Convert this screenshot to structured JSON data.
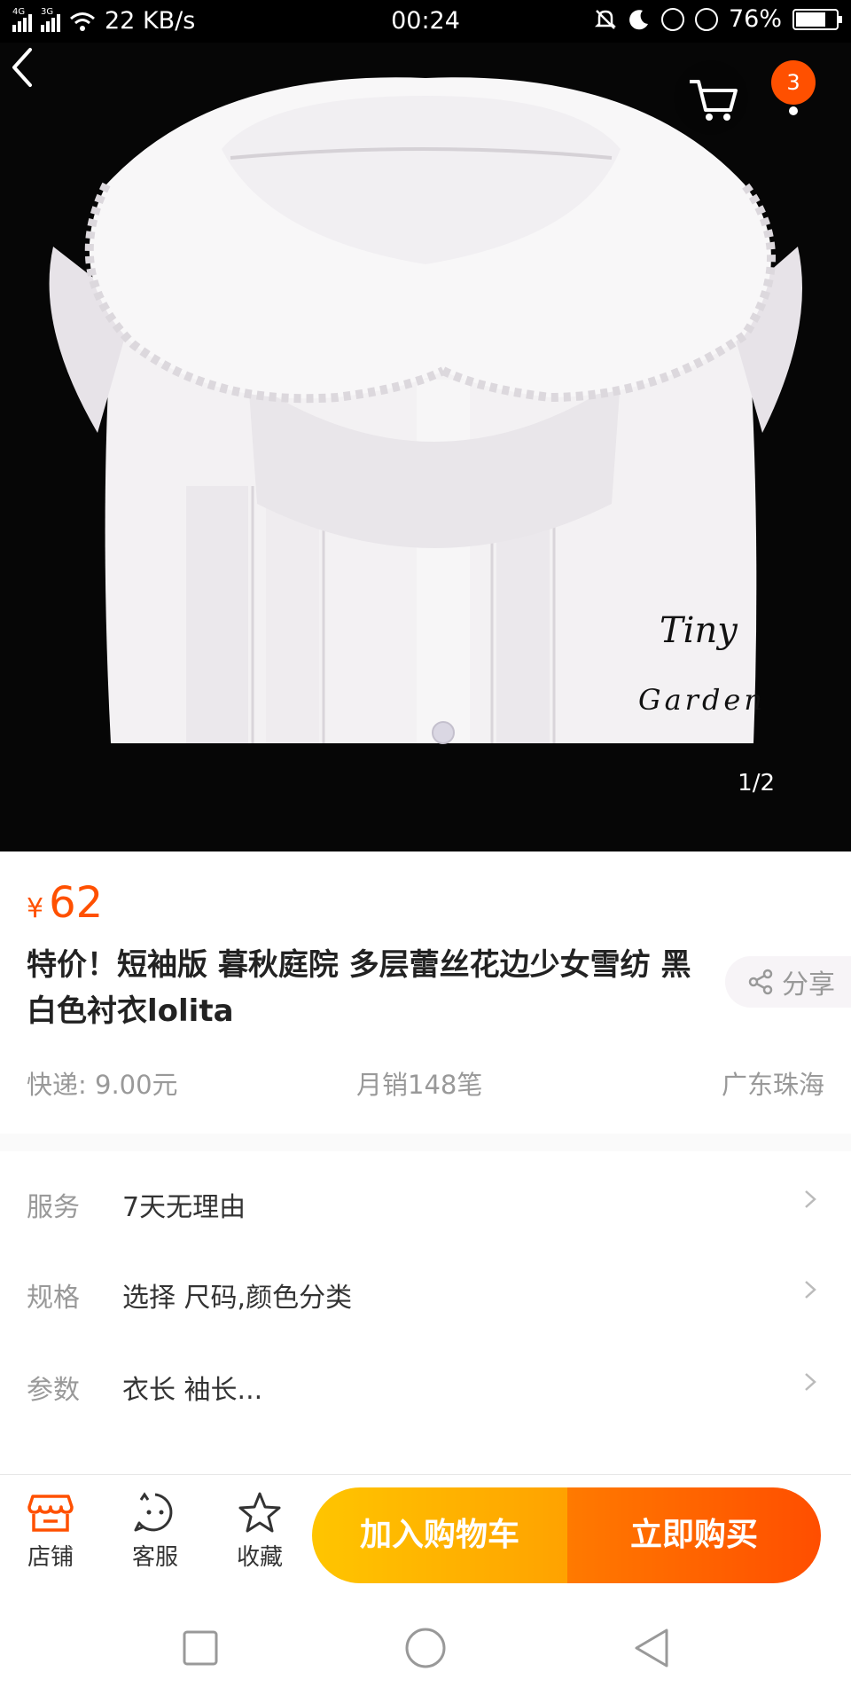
{
  "status_bar": {
    "network_label_1": "4G",
    "network_label_2": "3G",
    "speed": "22 KB/s",
    "time": "00:24",
    "battery": "76%",
    "battery_level": 0.76
  },
  "hero": {
    "pager": "1/2",
    "brand_line_1": "Tiny",
    "brand_line_2": "Garden",
    "cart_badge_count": "3"
  },
  "product": {
    "currency": "¥",
    "price": "62",
    "title": "特价！短袖版 暮秋庭院 多层蕾丝花边少女雪纺 黑白色衬衣lolita",
    "share_label": "分享",
    "shipping": "快递: 9.00元",
    "monthly_sales": "月销148笔",
    "location": "广东珠海"
  },
  "options": [
    {
      "key": "服务",
      "value": "7天无理由"
    },
    {
      "key": "规格",
      "value": "选择 尺码,颜色分类"
    },
    {
      "key": "参数",
      "value": "衣长 袖长..."
    }
  ],
  "bottom_bar": {
    "shop": "店铺",
    "service": "客服",
    "favorite": "收藏",
    "add_to_cart": "加入购物车",
    "buy_now": "立即购买"
  },
  "colors": {
    "accent": "#ff5000",
    "cart_button": "#ffb300",
    "buy_button": "#ff5a00"
  }
}
